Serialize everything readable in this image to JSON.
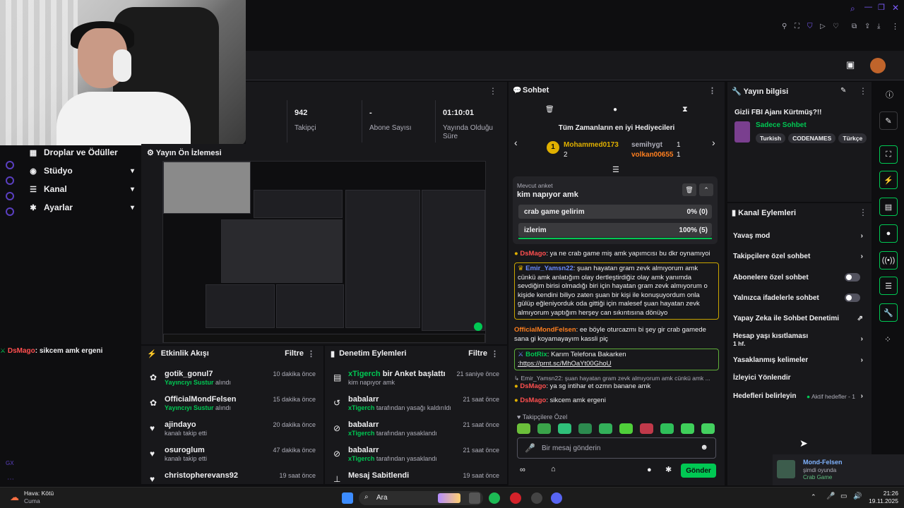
{
  "webcam": {
    "label": "webcam-overlay"
  },
  "nav": {
    "items": [
      {
        "label": "Droplar ve Ödüller",
        "icon": "gift-icon"
      },
      {
        "label": "Stüdyo",
        "icon": "camera-icon"
      },
      {
        "label": "Kanal",
        "icon": "channel-icon"
      },
      {
        "label": "Ayarlar",
        "icon": "gear-icon"
      }
    ]
  },
  "left_chat": {
    "user": "DsMago",
    "text": ": sikcem amk ergeni"
  },
  "stats": [
    {
      "value": "942",
      "label": "Takipçi"
    },
    {
      "value": "-",
      "label": "Abone Sayısı"
    },
    {
      "value": "01:10:01",
      "label": "Yayında Olduğu Süre"
    }
  ],
  "preview": {
    "title": "Yayın Ön İzlemesi"
  },
  "activity": {
    "title": "Etkinlik Akışı",
    "filter": "Filtre",
    "rows": [
      {
        "name": "gotik_gonul7",
        "sub_green": "Yayıncıyı Sustur",
        "sub": " alındı",
        "time": "10 dakika önce"
      },
      {
        "name": "OfficialMondFelsen",
        "sub_green": "Yayıncıyı Sustur",
        "sub": " alındı",
        "time": "15 dakika önce"
      },
      {
        "name": "ajindayo",
        "sub_green": "",
        "sub": "kanalı takip etti",
        "time": "20 dakika önce"
      },
      {
        "name": "osuroglum",
        "sub_green": "",
        "sub": "kanalı takip etti",
        "time": "47 dakika önce"
      },
      {
        "name": "christopherevans92",
        "sub_green": "",
        "sub": "",
        "time": "19 saat önce"
      }
    ]
  },
  "modactions": {
    "title": "Denetim Eylemleri",
    "filter": "Filtre",
    "rows": [
      {
        "name_green": "xTigerch",
        "name": " bir Anket başlattı",
        "sub_green": "",
        "sub": "kim napıyor amk",
        "time": "21 saniye önce"
      },
      {
        "name_green": "",
        "name": "babalarr",
        "sub_green": "xTigerch",
        "sub": " tarafından yasağı kaldırıldı",
        "time": "21 saat önce"
      },
      {
        "name_green": "",
        "name": "babalarr",
        "sub_green": "xTigerch",
        "sub": " tarafından yasaklandı",
        "time": "21 saat önce"
      },
      {
        "name_green": "",
        "name": "babalarr",
        "sub_green": "xTigerch",
        "sub": " tarafından yasaklandı",
        "time": "21 saat önce"
      },
      {
        "name_green": "",
        "name": "Mesaj Sabitlendi",
        "sub_green": "",
        "sub": "",
        "time": "19 saat önce"
      }
    ]
  },
  "chat": {
    "title": "Sohbet",
    "top_gifters_title": "Tüm Zamanların en iyi Hediyecileri",
    "gifters": [
      {
        "rank": "1",
        "name": "Mohammed0173",
        "count": "2"
      },
      {
        "rank": "",
        "name": "semihygt",
        "count": "1"
      },
      {
        "rank": "",
        "name": "volkan00655",
        "count": "1"
      }
    ],
    "poll": {
      "label": "Mevcut anket",
      "question": "kim napıyor amk",
      "options": [
        {
          "text": "crab game gelirim",
          "result": "0% (0)",
          "fill": 0
        },
        {
          "text": "izlerim",
          "result": "100% (5)",
          "fill": 100
        }
      ]
    },
    "messages": [
      {
        "user": "DsMago",
        "text": ": ya ne crab game miş amk yapımcısı bu dkr oynamıyoi",
        "color": "#ff4f4f"
      },
      {
        "user": "Emir_Yamsn22",
        "text": ": şuan hayatan gram zevk almıyorum amk cünkü amk anlatığım olay dertleştirdiğiz olay amk yanımda sevdiğim birisi olmadığı biri için hayatan gram zevk almıyorum o kişide kendini biliyo zaten şuan bir kişi ile konuşuyordum onla gülüp eğleniyorduk oda gittiği için malesef şuan hayatan zevk almıyorum yaptığım herşey can sıkıntısına dönüyo",
        "color": "#6a8cff"
      },
      {
        "user": "OfficialMondFelsen",
        "text": ": ee böyle oturcazmı bi şey gir crab gamede sana gi koyamayayım kassli piç",
        "color": "#ff7f1f"
      },
      {
        "user": "BotRix",
        "text": ": Karım Telefona Bakarken",
        "link": ":https://prnt.sc/MhOaYt00GhoU",
        "color": "#00c853"
      },
      {
        "user": "Emir_Yamsn22",
        "text": ": şuan hayatan gram zevk almıyorum amk cünkü amk ...",
        "color": "#adadb8"
      },
      {
        "user": "DsMago",
        "text": ": ya sg intihar et ozmn banane amk",
        "color": "#ff4f4f"
      },
      {
        "user": "DsMago",
        "text": ": sikcem amk ergeni",
        "color": "#ff4f4f"
      }
    ],
    "followers_only": "Takipçilere Özel",
    "input_placeholder": "Bir mesaj gönderin",
    "send": "Gönder"
  },
  "stream_info": {
    "title": "Yayın bilgisi",
    "stream_title": "Gizli FBI Ajanı Kürtmüş?!!",
    "category": "Sadece Sohbet",
    "tags": [
      "Turkish",
      "CODENAMES",
      "Türkçe"
    ]
  },
  "channel_actions": {
    "title": "Kanal Eylemleri",
    "rows": [
      {
        "label": "Yavaş mod",
        "kind": "chev"
      },
      {
        "label": "Takipçilere özel sohbet",
        "kind": "chev"
      },
      {
        "label": "Abonelere özel sohbet",
        "kind": "toggle"
      },
      {
        "label": "Yalnızca ifadelerle sohbet",
        "kind": "toggle"
      },
      {
        "label": "Yapay Zeka ile Sohbet Denetimi",
        "kind": "ext"
      },
      {
        "label": "Hesap yaşı kısıtlaması",
        "kind": "chev",
        "sub": "1 hf."
      },
      {
        "label": "Yasaklanmış kelimeler",
        "kind": "chev"
      },
      {
        "label": "İzleyici Yönlendir",
        "kind": "none"
      },
      {
        "label": "Hedefleri belirleyin",
        "kind": "chev",
        "extra": "Aktif hedefler - 1"
      }
    ]
  },
  "notification": {
    "name": "Mond-Felsen",
    "status": "şimdi oyunda",
    "game": "Crab Game"
  },
  "taskbar": {
    "weather_title": "Hava: Kötü",
    "weather_sub": "Cuma",
    "search": "Ara",
    "time": "21:26",
    "date": "19.11.2025"
  },
  "colors": {
    "accent": "#00c853",
    "bg": "#0e0e10",
    "panel": "#18181b"
  }
}
